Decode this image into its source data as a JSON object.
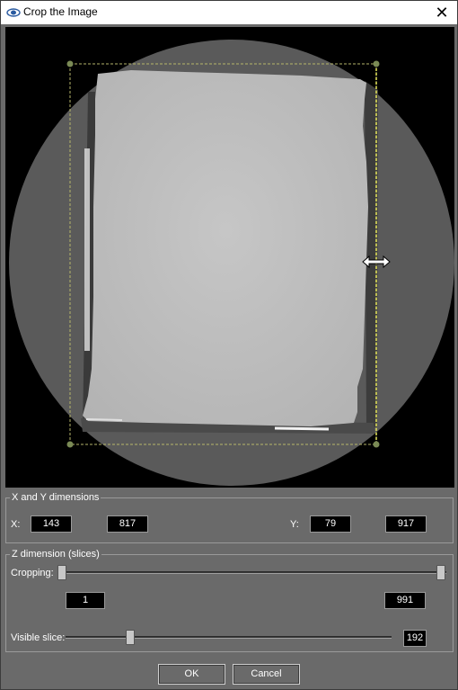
{
  "window": {
    "title": "Crop the Image",
    "close_glyph": "✕",
    "icon": "eye-icon"
  },
  "xy": {
    "legend": "X and Y dimensions",
    "x_label": "X:",
    "x_min": "143",
    "x_max": "817",
    "y_label": "Y:",
    "y_min": "79",
    "y_max": "917"
  },
  "z": {
    "legend": "Z dimension (slices)",
    "cropping_label": "Cropping:",
    "crop_min": "1",
    "crop_max": "991",
    "crop_min_fraction": 0.0,
    "crop_max_fraction": 1.0,
    "visible_label": "Visible slice:",
    "visible_value": "192",
    "visible_fraction": 0.193
  },
  "buttons": {
    "ok": "OK",
    "cancel": "Cancel"
  },
  "colors": {
    "crop_outline": "#b5b56a",
    "active_edge": "#e8e85a",
    "handle": "#7a8a55"
  }
}
